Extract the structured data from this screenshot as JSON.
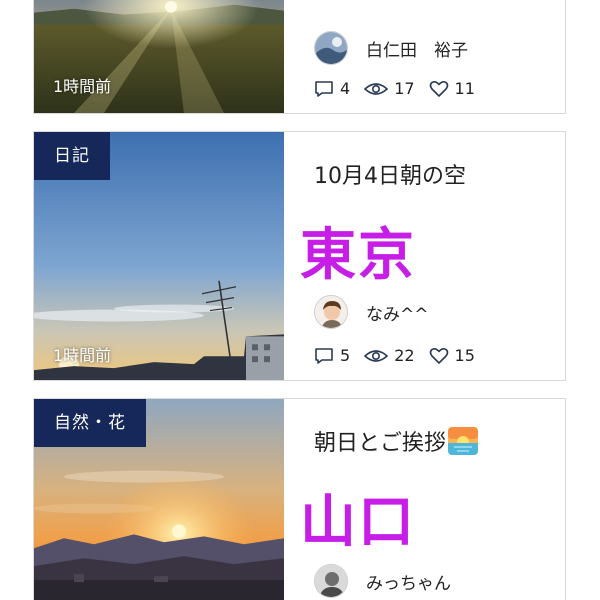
{
  "posts": [
    {
      "time": "1時間前",
      "author": "白仁田　裕子",
      "stats": {
        "comments": "4",
        "views": "17",
        "likes": "11"
      }
    },
    {
      "category": "日記",
      "title": "10月4日朝の空",
      "region": "東京",
      "time": "1時間前",
      "author": "なみ^^",
      "stats": {
        "comments": "5",
        "views": "22",
        "likes": "15"
      }
    },
    {
      "category": "自然・花",
      "title": "朝日とご挨拶",
      "title_emoji": "sunrise-emoji-icon",
      "region": "山口",
      "author": "みっちゃん"
    }
  ],
  "colors": {
    "category_bg": "#16285a",
    "region_text": "#c61ee6",
    "card_border": "#d9d9d9"
  }
}
